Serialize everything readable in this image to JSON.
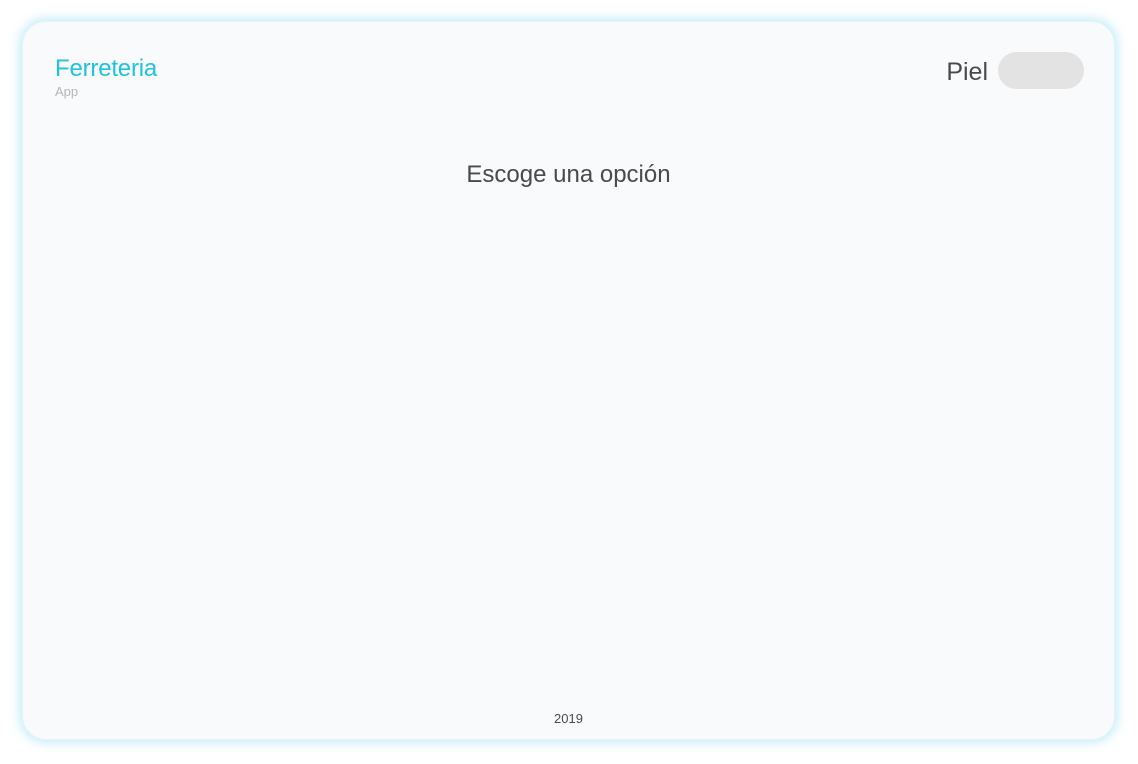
{
  "header": {
    "app_title": "Ferreteria",
    "app_subtitle": "App",
    "skin_label": "Piel",
    "skin_toggle_on": false
  },
  "main": {
    "heading": "Escoge una opción"
  },
  "footer": {
    "year": "2019"
  },
  "colors": {
    "accent": "#1fc3dd",
    "toggle_off": "#e3e3e3",
    "background": "#f9fafc"
  }
}
